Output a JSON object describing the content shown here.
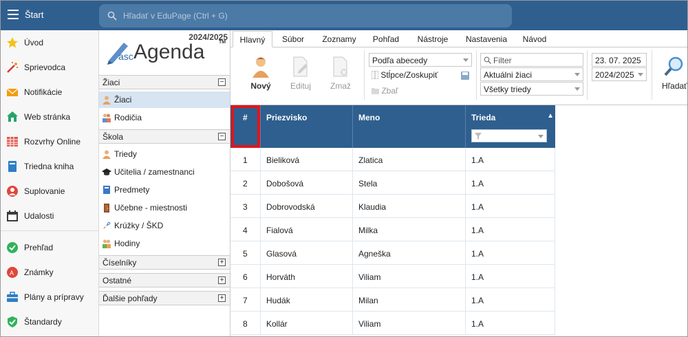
{
  "topbar": {
    "title": "Štart",
    "search_placeholder": "Hľadať v EduPage (Ctrl + G)"
  },
  "left_nav": {
    "items": [
      {
        "label": "Úvod",
        "icon": "star-icon"
      },
      {
        "label": "Sprievodca",
        "icon": "magic-wand-icon"
      },
      {
        "label": "Notifikácie",
        "icon": "envelope-icon"
      },
      {
        "label": "Web stránka",
        "icon": "house-icon"
      },
      {
        "label": "Rozvrhy Online",
        "icon": "timetable-icon"
      },
      {
        "label": "Triedna kniha",
        "icon": "book-icon"
      },
      {
        "label": "Suplovanie",
        "icon": "substitute-icon"
      },
      {
        "label": "Udalosti",
        "icon": "calendar-icon"
      },
      {
        "label": "Prehľad",
        "icon": "check-circle-icon"
      },
      {
        "label": "Známky",
        "icon": "grades-icon"
      },
      {
        "label": "Plány a prípravy",
        "icon": "briefcase-icon"
      },
      {
        "label": "Štandardy",
        "icon": "shield-check-icon"
      }
    ]
  },
  "agenda": {
    "year": "2024/2025",
    "logo": {
      "asc": "asc",
      "name": "Agenda",
      "tm": "TM"
    },
    "sections": [
      {
        "label": "Žiaci",
        "toggle": "−",
        "items": [
          {
            "label": "Žiaci",
            "icon": "student-icon",
            "selected": true
          },
          {
            "label": "Rodičia",
            "icon": "parents-icon"
          }
        ]
      },
      {
        "label": "Škola",
        "toggle": "−",
        "items": [
          {
            "label": "Triedy",
            "icon": "class-icon"
          },
          {
            "label": "Učitelia / zamestnanci",
            "icon": "graduation-cap-icon"
          },
          {
            "label": "Predmety",
            "icon": "subject-book-icon"
          },
          {
            "label": "Učebne - miestnosti",
            "icon": "door-icon"
          },
          {
            "label": "Krúžky / ŠKD",
            "icon": "rocket-icon"
          },
          {
            "label": "Hodiny",
            "icon": "people-icon"
          }
        ]
      },
      {
        "label": "Číselníky",
        "toggle": "+"
      },
      {
        "label": "Ostatné",
        "toggle": "+"
      },
      {
        "label": "Ďalšie pohľady",
        "toggle": "+"
      }
    ]
  },
  "ribbon": {
    "tabs": [
      "Hlavný",
      "Súbor",
      "Zoznamy",
      "Pohľad",
      "Nástroje",
      "Nastavenia",
      "Návod"
    ],
    "active_tab": "Hlavný",
    "buttons": {
      "new": "Nový",
      "edit": "Edituj",
      "delete": "Zmaž",
      "search": "Hľadať"
    },
    "sort": "Podľa abecedy",
    "columns": "Stĺpce/Zoskupiť",
    "collapse": "Zbaľ",
    "filter_placeholder": "Filter",
    "filter_students": "Aktuálni žiaci",
    "filter_classes": "Všetky triedy",
    "date": "23. 07. 2025",
    "school_year": "2024/2025"
  },
  "grid": {
    "columns": [
      "#",
      "Priezvisko",
      "Meno",
      "Trieda"
    ],
    "sort_indicator": "▲",
    "rows": [
      [
        "1",
        "Bieliková",
        "Zlatica",
        "1.A"
      ],
      [
        "2",
        "Dobošová",
        "Stela",
        "1.A"
      ],
      [
        "3",
        "Dobrovodská",
        "Klaudia",
        "1.A"
      ],
      [
        "4",
        "Fialová",
        "Milka",
        "1.A"
      ],
      [
        "5",
        "Glasová",
        "Agneška",
        "1.A"
      ],
      [
        "6",
        "Horváth",
        "Viliam",
        "1.A"
      ],
      [
        "7",
        "Hudák",
        "Milan",
        "1.A"
      ],
      [
        "8",
        "Kollár",
        "Viliam",
        "1.A"
      ]
    ]
  },
  "colors": {
    "header": "#2f5f8f",
    "selection": "#d7e4f1",
    "highlight": "#e0151b"
  }
}
